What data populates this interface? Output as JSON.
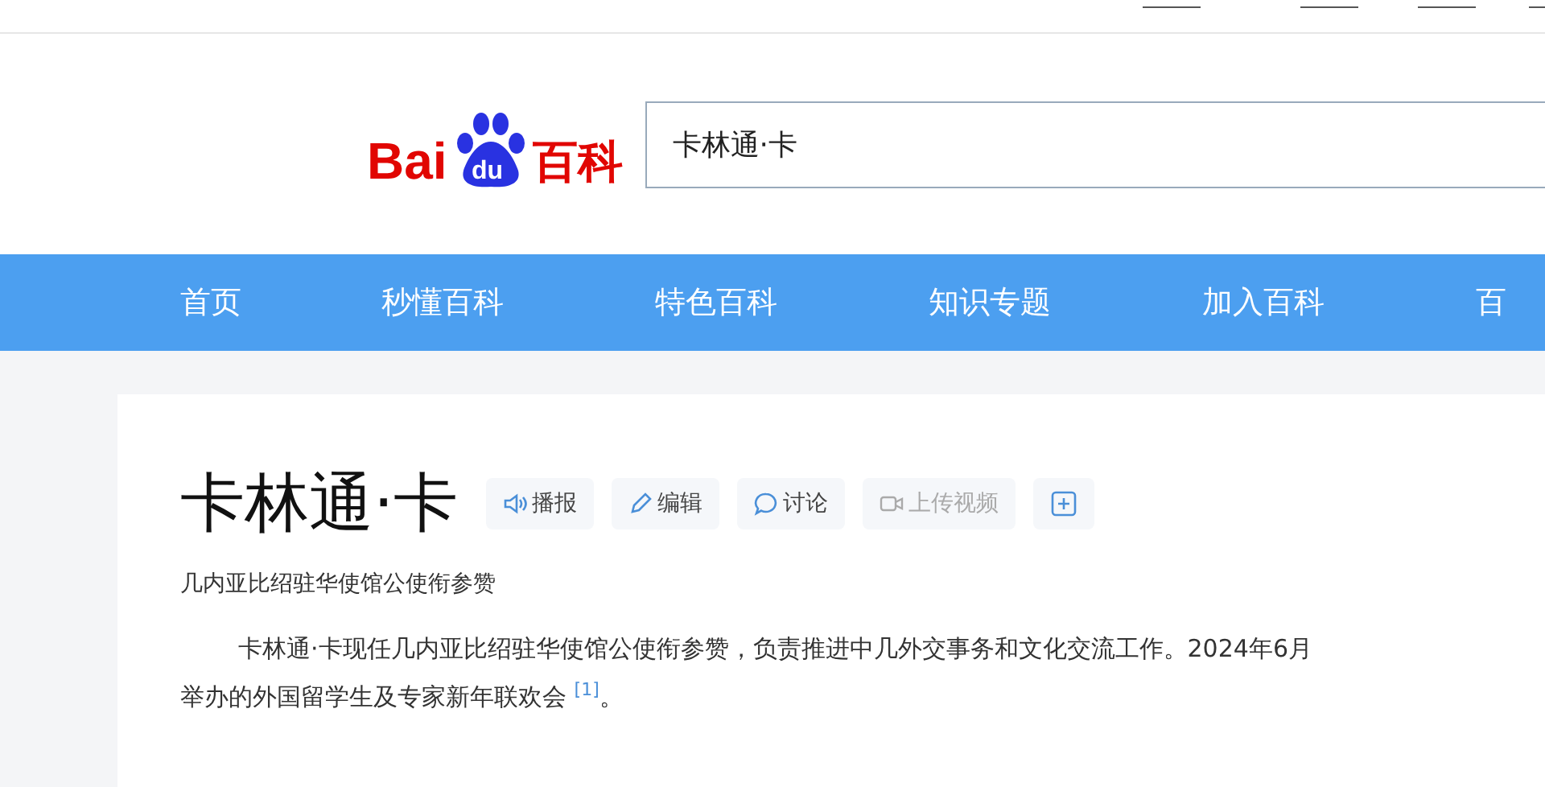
{
  "logo": {
    "latin": "Bai",
    "badge": "du",
    "chinese": "百科"
  },
  "search": {
    "value": "卡林通·卡"
  },
  "nav": [
    "首页",
    "秒懂百科",
    "特色百科",
    "知识专题",
    "加入百科",
    "百"
  ],
  "entry": {
    "title": "卡林通·卡",
    "actions": [
      {
        "kind": "speaker",
        "label": "播报",
        "disabled": false
      },
      {
        "kind": "pencil",
        "label": "编辑",
        "disabled": false
      },
      {
        "kind": "bubble",
        "label": "讨论",
        "disabled": false
      },
      {
        "kind": "camera",
        "label": "上传视频",
        "disabled": true
      },
      {
        "kind": "plus"
      }
    ],
    "subtitle": "几内亚比绍驻华使馆公使衔参赞",
    "paragraph": "卡林通·卡现任几内亚比绍驻华使馆公使衔参赞，负责推进中几外交事务和文化交流工作。2024年6月举办的外国留学生及专家新年联欢会 $^{[1]}$。"
  }
}
